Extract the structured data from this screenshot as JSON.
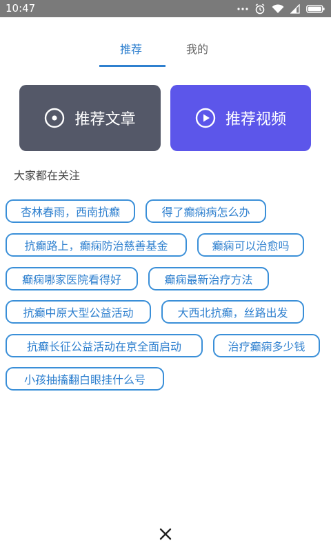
{
  "status_bar": {
    "time": "10:47"
  },
  "tabs": [
    {
      "label": "推荐"
    },
    {
      "label": "我的"
    }
  ],
  "cards": [
    {
      "label": "推荐文章",
      "icon": "target-icon",
      "color": "#545868"
    },
    {
      "label": "推荐视频",
      "icon": "play-icon",
      "color": "#5c56ea"
    }
  ],
  "section_title": "大家都在关注",
  "tags": [
    "杏林春雨，西南抗癫",
    "得了癫痫病怎么办",
    "抗癫路上，癫痫防治慈善基金",
    "癫痫可以治愈吗",
    "癫痫哪家医院看得好",
    "癫痫最新治疗方法",
    "抗癫中原大型公益活动",
    "大西北抗癫，丝路出发",
    "抗癫长征公益活动在京全面启动",
    "治疗癫痫多少钱",
    "小孩抽搐翻白眼挂什么号"
  ],
  "colors": {
    "accent": "#2f80cf",
    "tag_border": "#3a8fd8",
    "status_bar": "#7a7a7a"
  }
}
